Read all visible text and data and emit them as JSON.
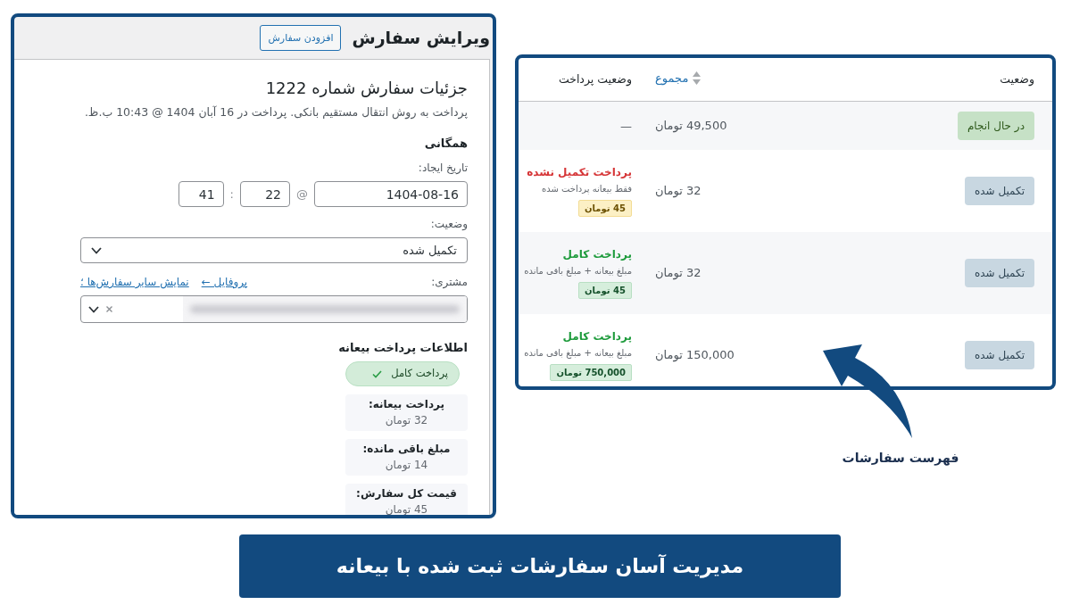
{
  "edit_order": {
    "title": "ویرایش سفارش",
    "add_order_button": "افزودن سفارش",
    "heading": "جزئیات سفارش شماره 1222",
    "payment_note": "پرداخت به روش انتقال مستقیم بانکی. پرداخت در 16 آبان 1404 @ 10:43 ب.ظ.",
    "section_title": "همگانی",
    "date_created": {
      "label": "تاریخ ایجاد:",
      "date": "1404-08-16",
      "at_sign": "@",
      "hour": "22",
      "time_separator": ":",
      "minute": "41"
    },
    "status": {
      "label": "وضعیت:",
      "value": "تکمیل شده"
    },
    "customer": {
      "label": "مشتری:",
      "links": [
        "پروفایل ←",
        "نمایش سایر سفارش‌ها ؛"
      ]
    },
    "deposit_info": {
      "title": "اطلاعات پرداخت بیعانه",
      "badge": "پرداخت کامل",
      "items": [
        {
          "label": "پرداخت بیعانه:",
          "value": "32 تومان"
        },
        {
          "label": "مبلغ باقی مانده:",
          "value": "14 تومان"
        },
        {
          "label": "قیمت کل سفارش:",
          "value": "45 تومان"
        }
      ]
    }
  },
  "orders_list": {
    "columns": [
      {
        "label": "وضعیت",
        "sortable": false
      },
      {
        "label": "مجموع",
        "sortable": true
      },
      {
        "label": "وضعیت پرداخت",
        "sortable": false
      }
    ],
    "rows": [
      {
        "status": {
          "label": "در حال انجام",
          "kind": "processing"
        },
        "total": "49,500 تومان",
        "payment": {
          "kind": "none",
          "text": "—"
        }
      },
      {
        "status": {
          "label": "تکمیل شده",
          "kind": "completed"
        },
        "total": "32 تومان",
        "payment": {
          "kind": "partial",
          "title": "پرداخت تکمیل نشده",
          "note": "فقط بیعانه پرداخت شده",
          "amount": "45 تومان"
        }
      },
      {
        "status": {
          "label": "تکمیل شده",
          "kind": "completed"
        },
        "total": "32 تومان",
        "payment": {
          "kind": "full",
          "title": "پرداخت کامل",
          "note": "مبلغ بیعانه + مبلغ باقی مانده",
          "amount": "45 تومان"
        }
      },
      {
        "status": {
          "label": "تکمیل شده",
          "kind": "completed"
        },
        "total": "150,000 تومان",
        "payment": {
          "kind": "full",
          "title": "پرداخت کامل",
          "note": "مبلغ بیعانه + مبلغ باقی مانده",
          "amount": "750,000 تومان"
        }
      }
    ]
  },
  "callout": {
    "label": "فهرست سفارشات"
  },
  "banner": {
    "text": "مدیریت آسان سفارشات ثبت شده با بیعانه"
  }
}
